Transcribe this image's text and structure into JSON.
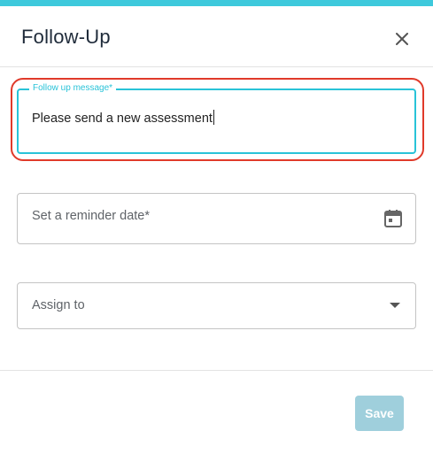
{
  "dialog": {
    "title": "Follow-Up",
    "close_icon": "close-icon"
  },
  "form": {
    "message": {
      "label": "Follow up message*",
      "value": "Please send a new assessment"
    },
    "reminder_date": {
      "placeholder": "Set a reminder date*",
      "icon": "calendar-icon"
    },
    "assign_to": {
      "placeholder": "Assign to",
      "icon": "chevron-down-icon"
    }
  },
  "footer": {
    "save_label": "Save"
  },
  "colors": {
    "accent": "#3ec9dc",
    "focus_border": "#29c3d8",
    "highlight": "#e03a2a",
    "save_disabled": "#9fcfdc"
  }
}
